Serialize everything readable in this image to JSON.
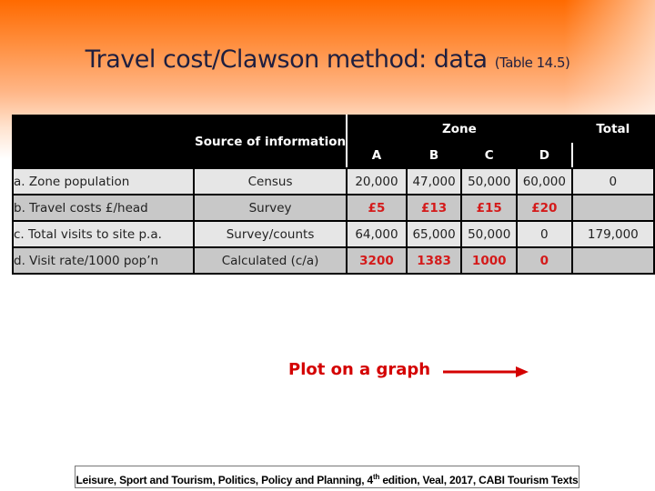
{
  "slide": {
    "title": "Travel cost/Clawson method: data",
    "title_ref": "(Table 14.5)"
  },
  "table": {
    "headers": {
      "source": "Source of information",
      "zone": "Zone",
      "total": "Total",
      "zones": [
        "A",
        "B",
        "C",
        "D"
      ]
    },
    "rows": [
      {
        "label": "a. Zone population",
        "source": "Census",
        "values": [
          "20,000",
          "47,000",
          "50,000",
          "60,000"
        ],
        "total": "0",
        "highlight": false
      },
      {
        "label": "b. Travel costs £/head",
        "source": "Survey",
        "values": [
          "£5",
          "£13",
          "£15",
          "£20"
        ],
        "total": "",
        "highlight": true
      },
      {
        "label": "c. Total visits to site p.a.",
        "source": "Survey/counts",
        "values": [
          "64,000",
          "65,000",
          "50,000",
          "0"
        ],
        "total": "179,000",
        "highlight": false
      },
      {
        "label": "d. Visit rate/1000 pop’n",
        "source": "Calculated (c/a)",
        "values": [
          "3200",
          "1383",
          "1000",
          "0"
        ],
        "total": "",
        "highlight": true
      }
    ]
  },
  "callout": {
    "text": "Plot on a graph",
    "icon": "right-arrow-icon",
    "color": "#d40000"
  },
  "citation": {
    "before": "Leisure, Sport and Tourism, Politics, Policy and Planning, 4",
    "sup": "th",
    "after": " edition, Veal, 2017, CABI Tourism Texts"
  },
  "colors": {
    "header_gradient_top": "#ff6a00",
    "highlight_text": "#d41a1a",
    "row_light": "#e6e6e6",
    "row_dark": "#c8c8c8"
  }
}
